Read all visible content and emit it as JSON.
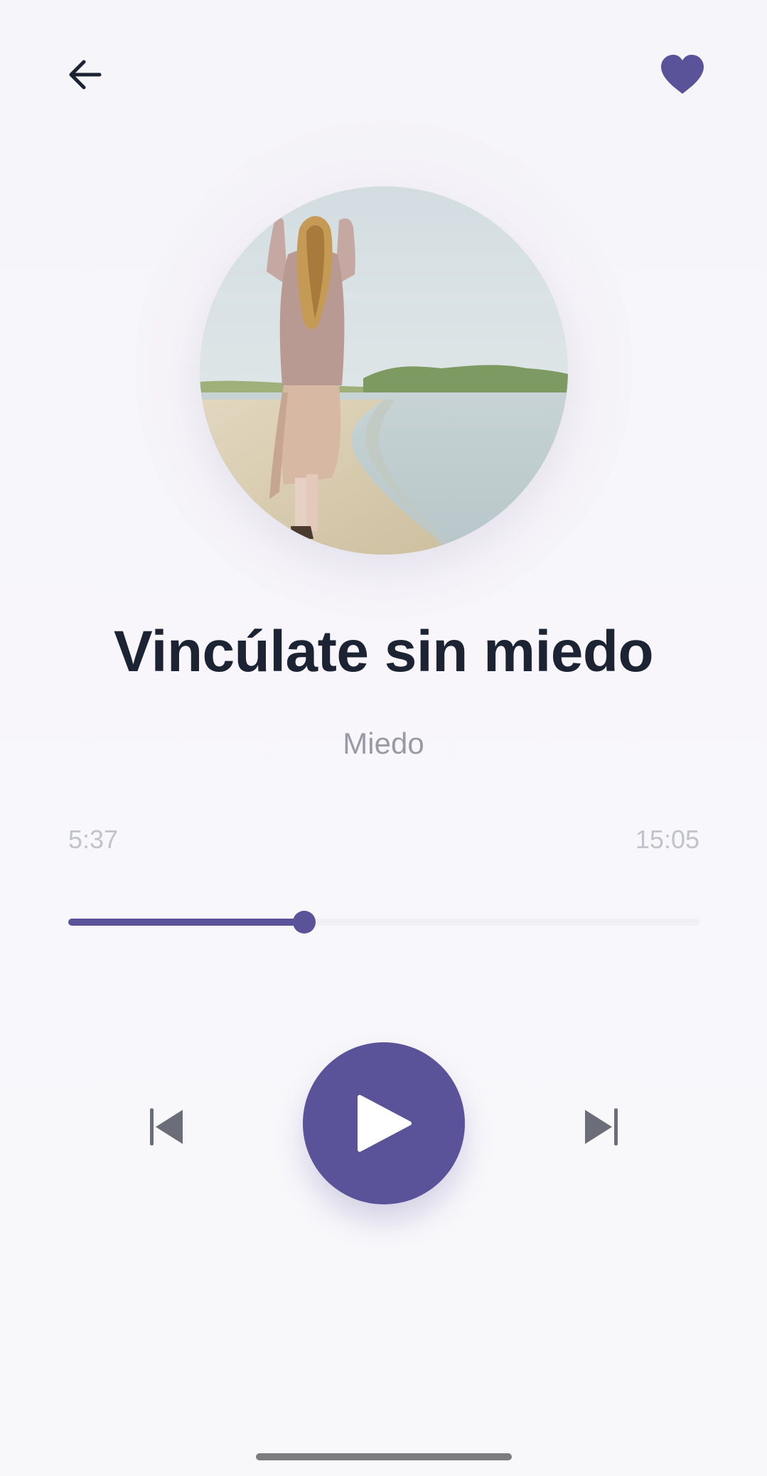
{
  "header": {
    "back_icon": "arrow-left-icon",
    "favorite_icon": "heart-icon",
    "accent_color": "#5a5399"
  },
  "track": {
    "title": "Vincúlate sin miedo",
    "category": "Miedo",
    "artwork": "woman walking on beach"
  },
  "player": {
    "elapsed": "5:37",
    "total": "15:05",
    "progress_fraction": 0.374,
    "prev_icon": "skip-previous-icon",
    "play_icon": "play-icon",
    "next_icon": "skip-next-icon"
  }
}
